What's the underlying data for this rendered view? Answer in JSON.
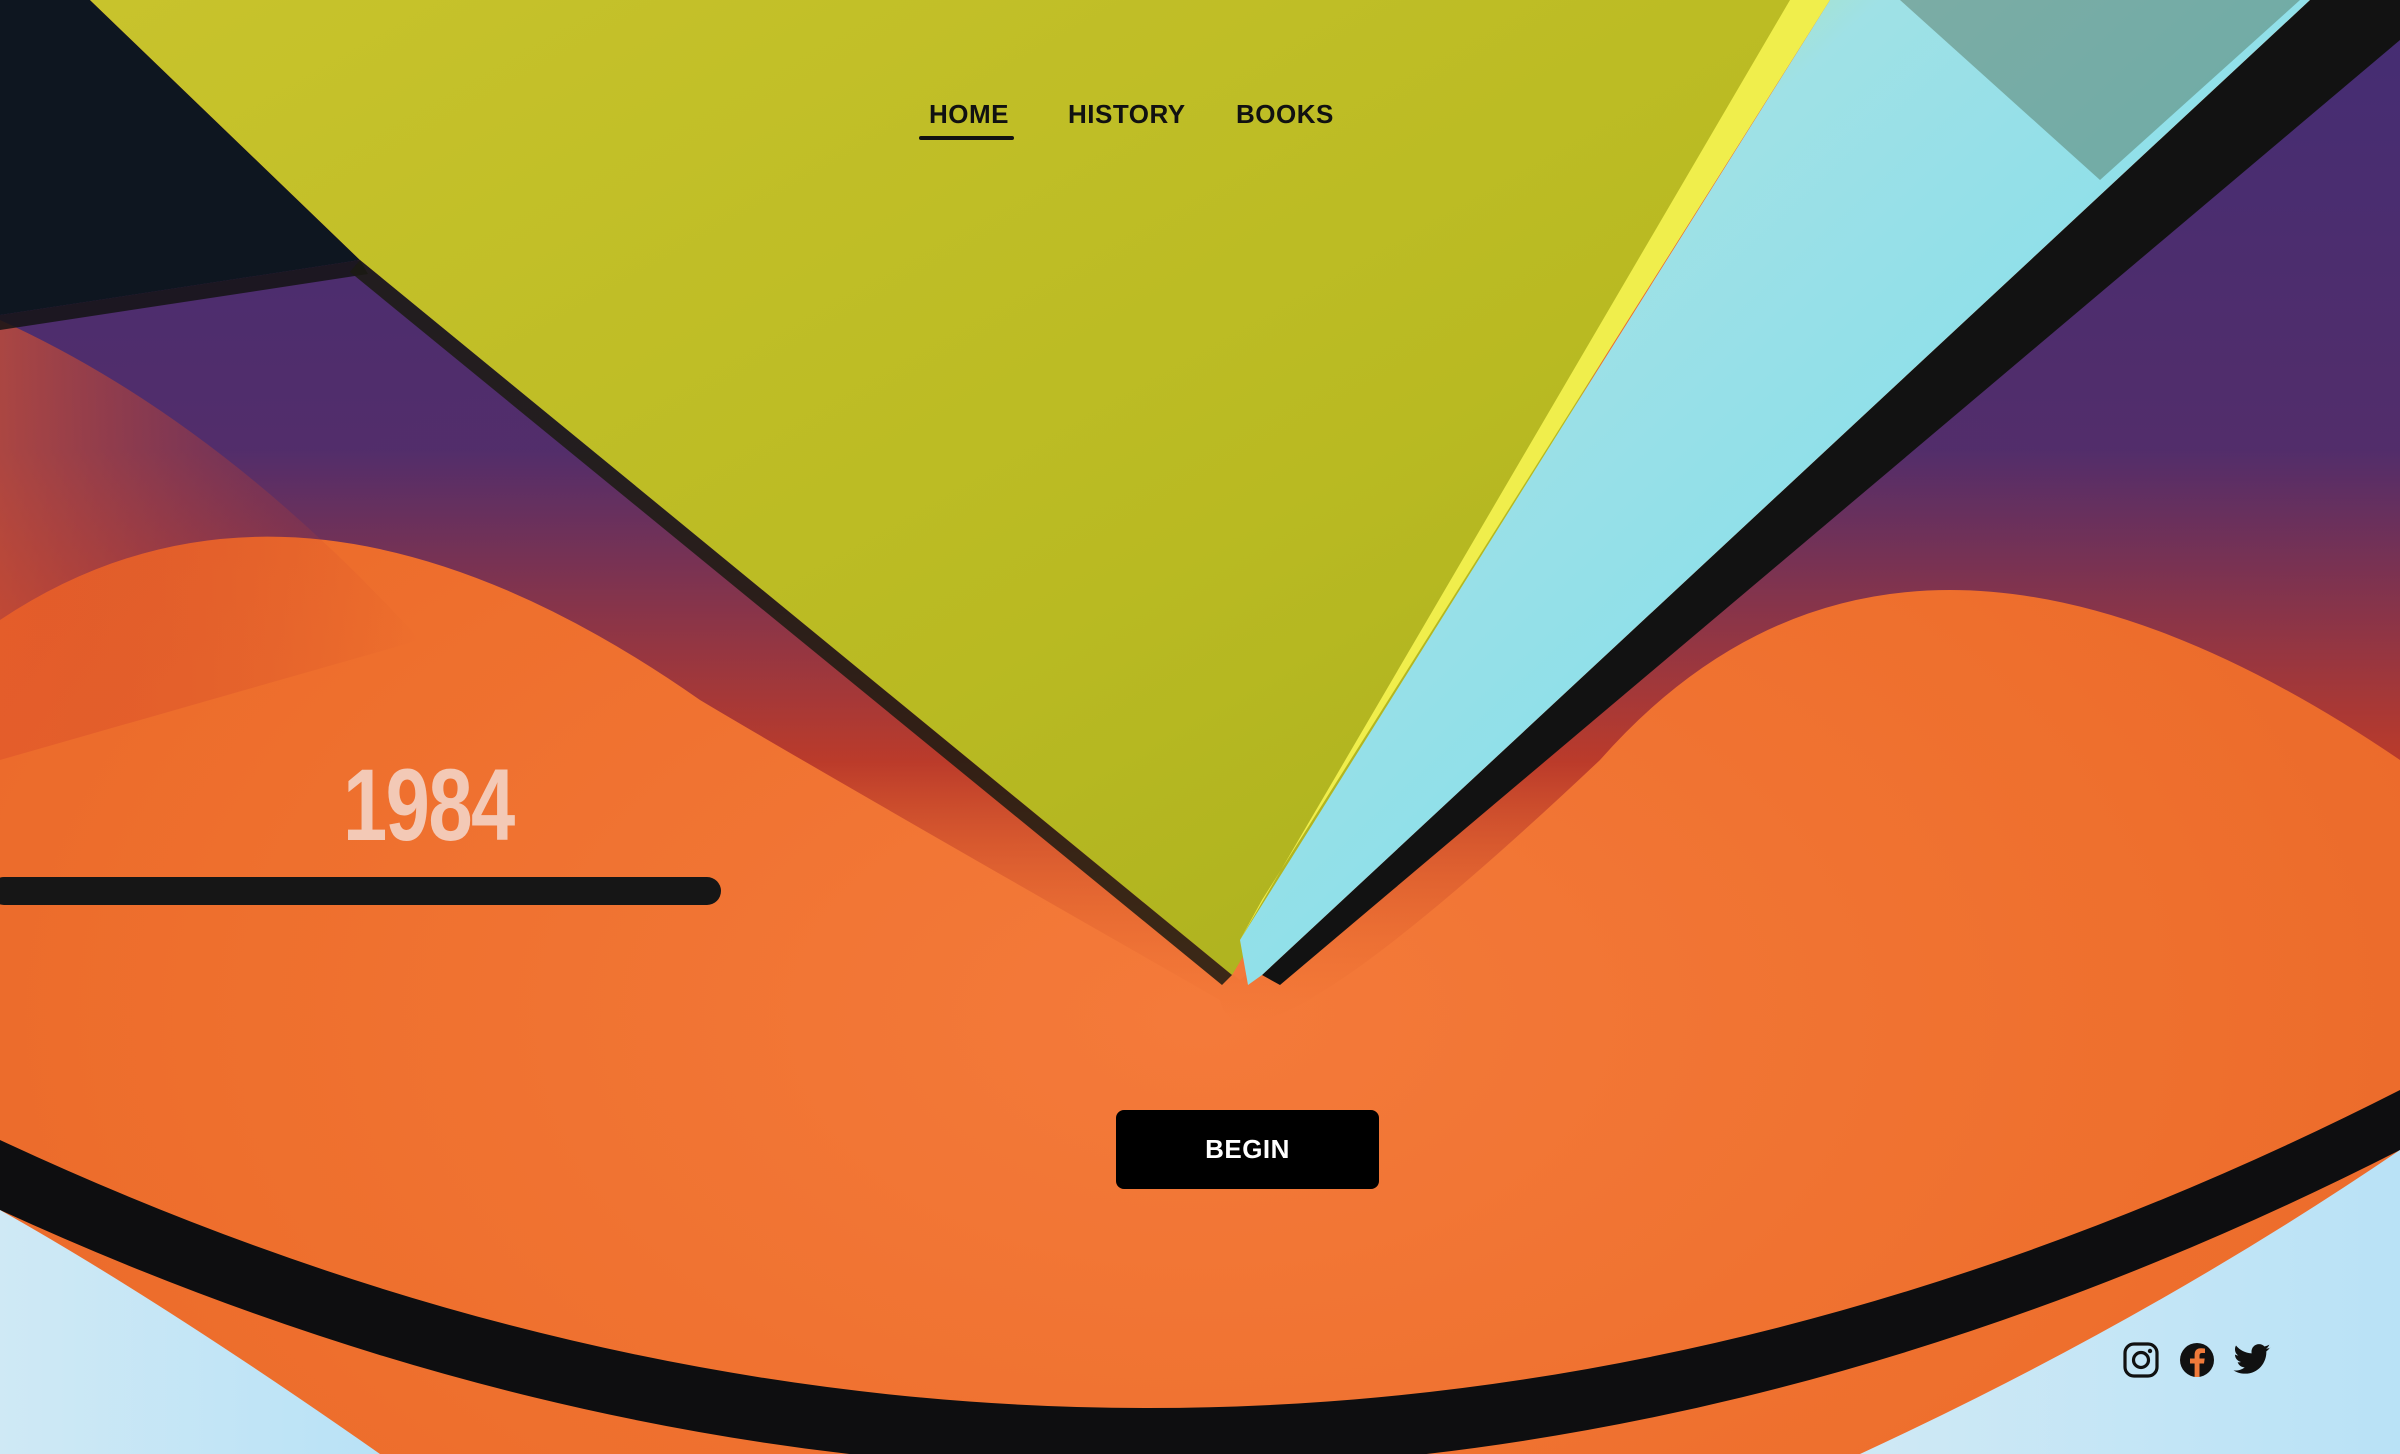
{
  "nav": {
    "items": [
      {
        "label": "HOME",
        "active": true
      },
      {
        "label": "HISTORY",
        "active": false
      },
      {
        "label": "BOOKS",
        "active": false
      }
    ]
  },
  "hero": {
    "year": "1984",
    "cta_label": "BEGIN"
  },
  "social": [
    {
      "icon": "instagram-icon"
    },
    {
      "icon": "facebook-icon"
    },
    {
      "icon": "twitter-icon"
    }
  ],
  "colors": {
    "text_dark": "#111111",
    "button_bg": "#000000",
    "button_text": "#ffffff",
    "year_color": "#f3c9b6",
    "orange": "#f07030",
    "lime": "#bcbc22",
    "purple": "#3d2a78",
    "cyan": "#7fe2f2"
  }
}
